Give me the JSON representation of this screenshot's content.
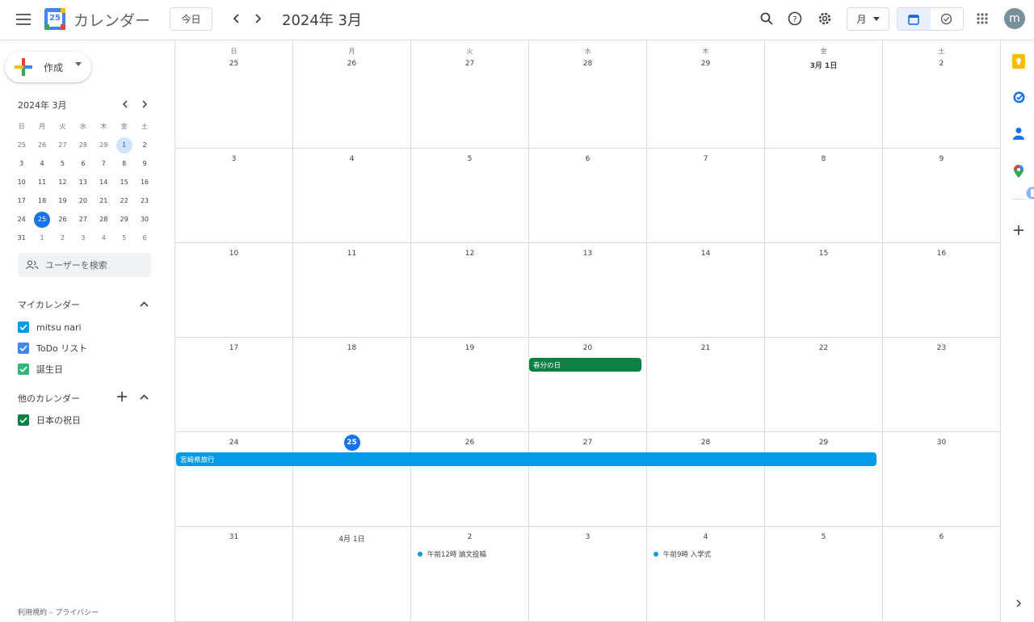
{
  "header": {
    "logo_day": "25",
    "app_title": "カレンダー",
    "today_label": "今日",
    "month_title": "2024年 3月",
    "view_label": "月",
    "avatar_letter": "m"
  },
  "sidebar": {
    "create_label": "作成",
    "mini_title": "2024年 3月",
    "mini_weekdays": [
      "日",
      "月",
      "火",
      "水",
      "木",
      "金",
      "土"
    ],
    "mini_weeks": [
      [
        "25",
        "26",
        "27",
        "28",
        "29",
        "1",
        "2"
      ],
      [
        "3",
        "4",
        "5",
        "6",
        "7",
        "8",
        "9"
      ],
      [
        "10",
        "11",
        "12",
        "13",
        "14",
        "15",
        "16"
      ],
      [
        "17",
        "18",
        "19",
        "20",
        "21",
        "22",
        "23"
      ],
      [
        "24",
        "25",
        "26",
        "27",
        "28",
        "29",
        "30"
      ],
      [
        "31",
        "1",
        "2",
        "3",
        "4",
        "5",
        "6"
      ]
    ],
    "people_search_placeholder": "ユーザーを検索",
    "my_calendars_title": "マイカレンダー",
    "my_calendars": [
      {
        "label": "mitsu nari",
        "color": "#039be5"
      },
      {
        "label": "ToDo リスト",
        "color": "#4285f4"
      },
      {
        "label": "誕生日",
        "color": "#33b679"
      }
    ],
    "other_calendars_title": "他のカレンダー",
    "other_calendars": [
      {
        "label": "日本の祝日",
        "color": "#0b8043"
      }
    ],
    "footer": "利用規約 – プライバシー"
  },
  "calendar": {
    "weekdays": [
      "日",
      "月",
      "火",
      "水",
      "木",
      "金",
      "土"
    ],
    "weeks": [
      [
        "25",
        "26",
        "27",
        "28",
        "29",
        "3月 1日",
        "2"
      ],
      [
        "3",
        "4",
        "5",
        "6",
        "7",
        "8",
        "9"
      ],
      [
        "10",
        "11",
        "12",
        "13",
        "14",
        "15",
        "16"
      ],
      [
        "17",
        "18",
        "19",
        "20",
        "21",
        "22",
        "23"
      ],
      [
        "24",
        "25",
        "26",
        "27",
        "28",
        "29",
        "30"
      ],
      [
        "31",
        "4月 1日",
        "2",
        "3",
        "4",
        "5",
        "6"
      ]
    ],
    "events": {
      "shunbun": {
        "title": "春分の日",
        "color": "#0b8043"
      },
      "trip": {
        "title": "宮崎県旅行",
        "color": "#039be5"
      },
      "paper": {
        "time": "午前12時",
        "title": "論文投稿"
      },
      "ceremony": {
        "time": "午前9時",
        "title": "入学式"
      }
    }
  },
  "colors": {
    "accent": "#1a73e8",
    "border": "#dadce0"
  }
}
